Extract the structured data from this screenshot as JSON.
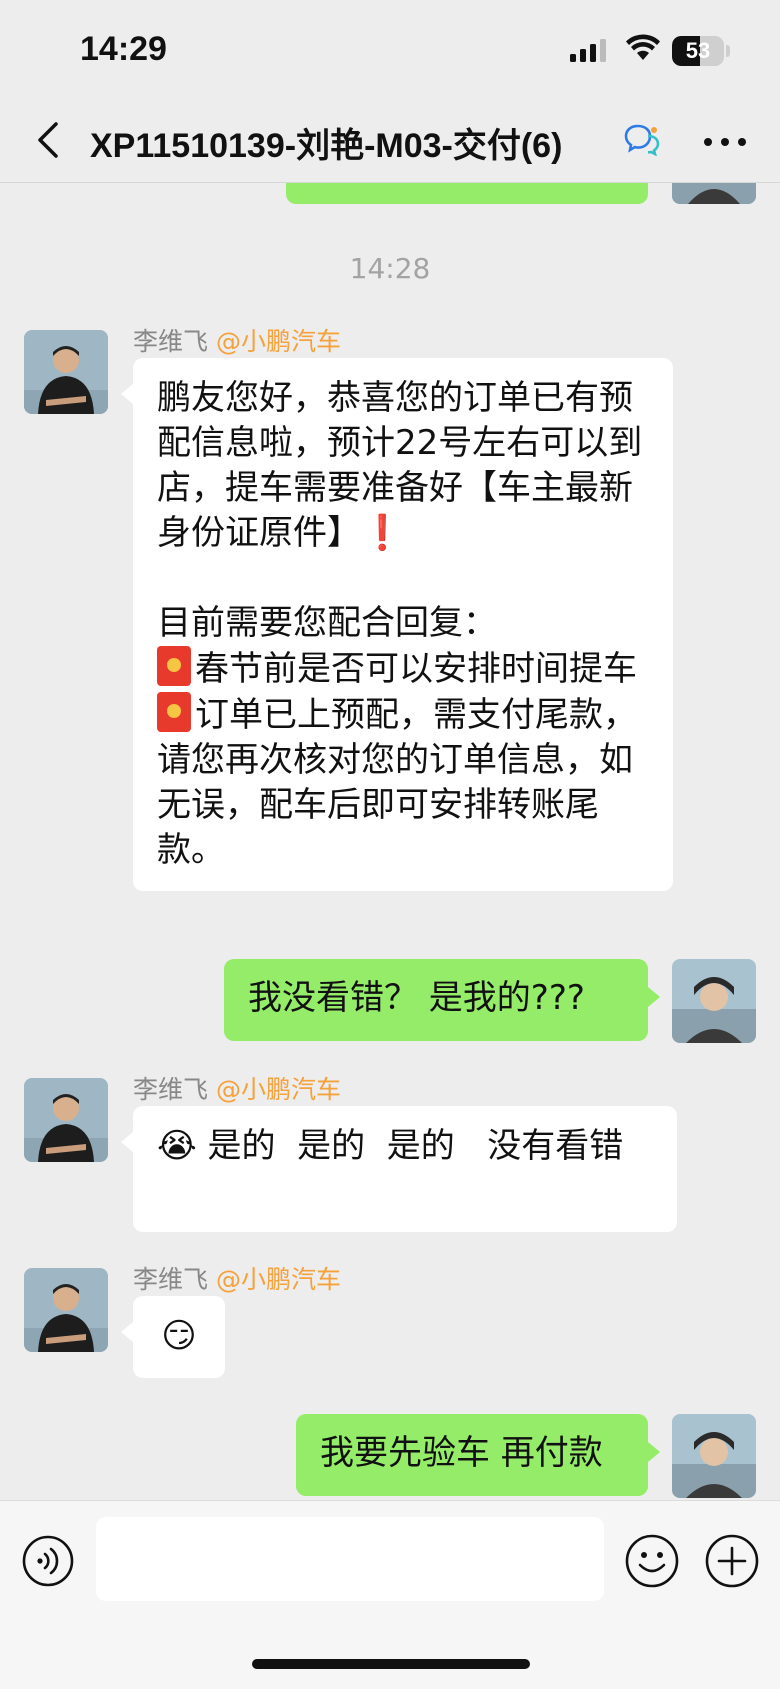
{
  "status_bar": {
    "time": "14:29",
    "battery": "53",
    "battery_level": 0.53
  },
  "header": {
    "title": "XP11510139-刘艳-M03-交付(6)",
    "back_icon": "chevron-left-icon",
    "more_icon": "more-dots-icon",
    "chat_icon": "chat-bubbles-icon"
  },
  "chat": {
    "timestamp": "14:28",
    "messages": [
      {
        "from": "李维飞",
        "org": "@小鹏汽车",
        "direction": "in",
        "para1": "鹏友您好，恭喜您的订单已有预配信息啦，预计22号左右可以到店，提车需要准备好【车主最新身份证原件】",
        "para1_suffix": "❗",
        "para2_head": "目前需要您配合回复：",
        "item1": "春节前是否可以安排时间提车",
        "item2": "订单已上预配，需支付尾款，请您再次核对您的订单信息，如无误，配车后即可安排转账尾款。",
        "item_icon": "red-envelope-icon"
      },
      {
        "direction": "out",
        "text": "我没看错？ 是我的???"
      },
      {
        "from": "李维飞",
        "org": "@小鹏汽车",
        "direction": "in",
        "emoji": "😭",
        "text": " 是的  是的  是的   没有看错"
      },
      {
        "from": "李维飞",
        "org": "@小鹏汽车",
        "direction": "in",
        "emoji": "😏"
      },
      {
        "direction": "out",
        "text": "我要先验车 再付款"
      }
    ]
  },
  "input_bar": {
    "voice_icon": "voice-icon",
    "emoji_icon": "emoji-icon",
    "plus_icon": "plus-icon"
  }
}
